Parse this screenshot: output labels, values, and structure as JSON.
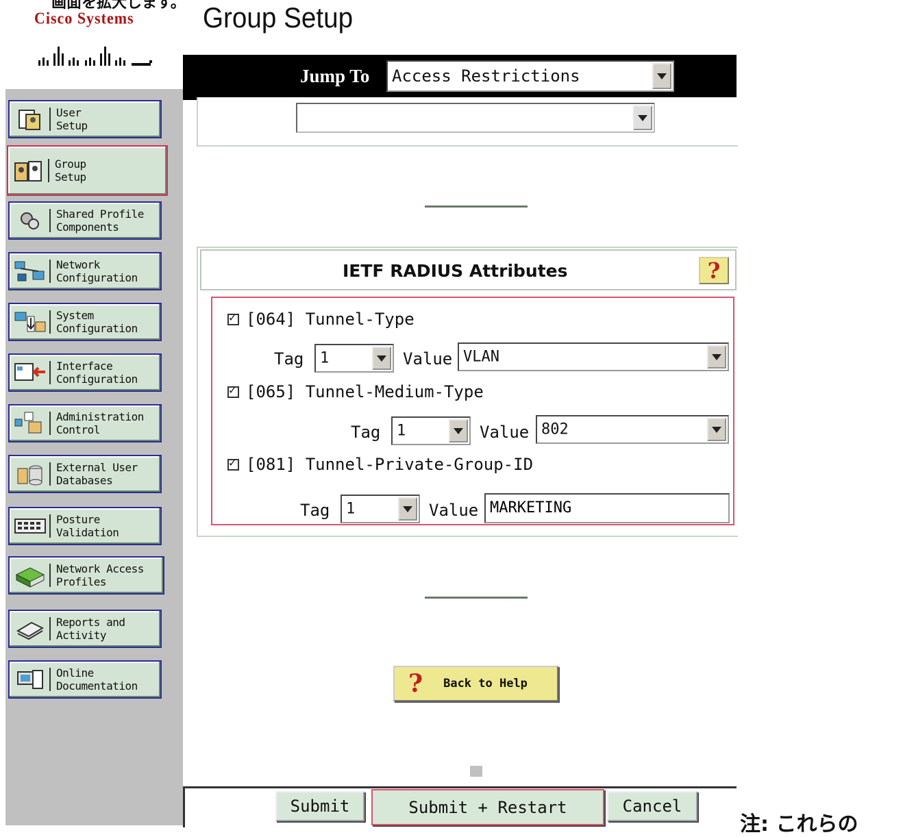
{
  "top_text": "画面を拡大します。",
  "logo": {
    "text": "Cisco Systems"
  },
  "page_title": "Group Setup",
  "jump": {
    "label": "Jump To",
    "selected": "Access Restrictions"
  },
  "sidebar": {
    "items": [
      {
        "label": "User\nSetup",
        "icon": "user-setup-icon"
      },
      {
        "label": "Group\nSetup",
        "icon": "group-setup-icon",
        "active": true
      },
      {
        "label": "Shared Profile\nComponents",
        "icon": "gears-icon"
      },
      {
        "label": "Network\nConfiguration",
        "icon": "network-config-icon"
      },
      {
        "label": "System\nConfiguration",
        "icon": "system-config-icon"
      },
      {
        "label": "Interface\nConfiguration",
        "icon": "interface-config-icon"
      },
      {
        "label": "Administration\nControl",
        "icon": "admin-control-icon"
      },
      {
        "label": "External User\nDatabases",
        "icon": "database-icon"
      },
      {
        "label": "Posture\nValidation",
        "icon": "posture-icon"
      },
      {
        "label": "Network Access\nProfiles",
        "icon": "network-access-icon"
      },
      {
        "label": "Reports and\nActivity",
        "icon": "reports-icon"
      },
      {
        "label": "Online\nDocumentation",
        "icon": "documentation-icon"
      }
    ]
  },
  "upper_select": {
    "value": ""
  },
  "ietf": {
    "title": "IETF RADIUS Attributes",
    "help": "?",
    "attrs": [
      {
        "checked": true,
        "label": "[064] Tunnel-Type",
        "tag_label": "Tag",
        "tag": "1",
        "value_label": "Value",
        "value": "VLAN"
      },
      {
        "checked": true,
        "label": "[065] Tunnel-Medium-Type",
        "tag_label": "Tag",
        "tag": "1",
        "value_label": "Value",
        "value": "802"
      },
      {
        "checked": true,
        "label": "[081] Tunnel-Private-Group-ID",
        "tag_label": "Tag",
        "tag": "1",
        "value_label": "Value",
        "value": "MARKETING"
      }
    ]
  },
  "back_to_help": "Back to Help",
  "buttons": {
    "submit": "Submit",
    "submit_restart": "Submit + Restart",
    "cancel": "Cancel"
  },
  "note": "注: これらの"
}
